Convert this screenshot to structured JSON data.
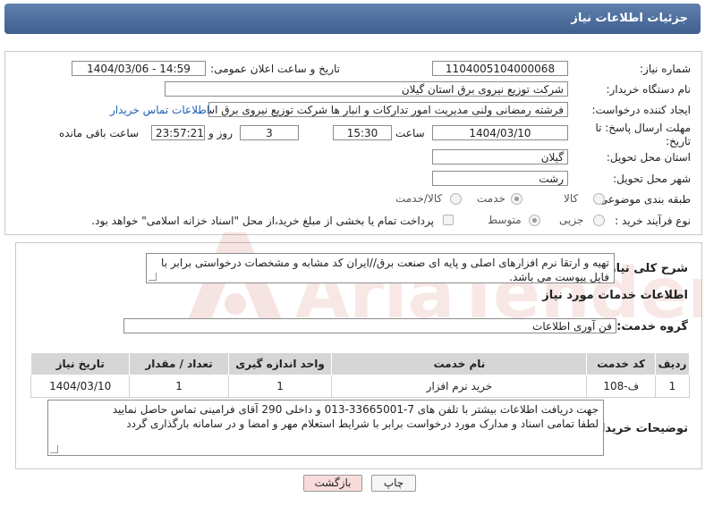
{
  "header": {
    "title": "جزئیات اطلاعات نیاز"
  },
  "labels": {
    "need_number": "شماره نیاز:",
    "announce_datetime": "تاریخ و ساعت اعلان عمومی:",
    "buyer_org": "نام دستگاه خریدار:",
    "requester": "ایجاد کننده درخواست:",
    "deadline": "مهلت ارسال پاسخ: تا تاریخ:",
    "time_word": "ساعت",
    "day_word": "روز و",
    "remaining": "ساعت باقی مانده",
    "province": "استان محل تحویل:",
    "city": "شهر محل تحویل:",
    "category": "طبقه بندی موضوعی:",
    "purchase_type": "نوع فرآیند خرید :",
    "description": "شرح کلی نیاز:",
    "services_info": "اطلاعات خدمات مورد نیاز",
    "service_group": "گروه خدمت:",
    "buyer_notes": "توضیحات خریدار:"
  },
  "fields": {
    "need_number": "1104005104000068",
    "announce_datetime": "1404/03/06 - 14:59",
    "buyer_org": "شرکت توزیع نیروی برق استان گیلان",
    "requester": "فرشته رمضانی ولنی مدیریت امور تدارکات و انبار ها شرکت توزیع نیروی برق استان گیلان",
    "contact_link": "اطلاعات تماس خریدار",
    "deadline_date": "1404/03/10",
    "deadline_time": "15:30",
    "days": "3",
    "remaining_time": "23:57:21",
    "province": "گیلان",
    "city": "رشت",
    "service_group": "فن آوری اطلاعات"
  },
  "category_options": [
    {
      "label": "کالا",
      "selected": false
    },
    {
      "label": "خدمت",
      "selected": true
    },
    {
      "label": "کالا/خدمت",
      "selected": false
    }
  ],
  "purchase_options": [
    {
      "label": "جزیی",
      "selected": false
    },
    {
      "label": "متوسط",
      "selected": true
    }
  ],
  "payment_note": "پرداخت تمام یا بخشی از مبلغ خرید،از محل \"اسناد خزانه اسلامی\" خواهد بود.",
  "description_text": "تهیه و ارتقا نرم افزارهای اصلی و پایه ای صنعت برق//ایران کد مشابه و مشخصات درخواستی برابر با فایل پیوست می باشد.",
  "table": {
    "headers": [
      "ردیف",
      "کد خدمت",
      "نام خدمت",
      "واحد اندازه گیری",
      "تعداد / مقدار",
      "تاریخ نیاز"
    ],
    "rows": [
      [
        "1",
        "ف-108",
        "خرید نرم افزار",
        "1",
        "1",
        "1404/03/10"
      ]
    ]
  },
  "notes_lines": [
    "جهت دریافت اطلاعات بیشتر با تلفن های 7-33665001-013 و داخلی 290 آقای فرامینی تماس حاصل نمایید",
    "لطفا تمامی اسناد و مدارک مورد درخواست برابر با شرایط استعلام مهر و امضا و در سامانه بارگذاری گردد"
  ],
  "buttons": {
    "print": "چاپ",
    "back": "بازگشت"
  },
  "watermark_text": "AriaTender.net",
  "colors": {
    "header": "#4a6b9c",
    "link": "#1a5fb4",
    "back_button": "#f8dcdc"
  }
}
